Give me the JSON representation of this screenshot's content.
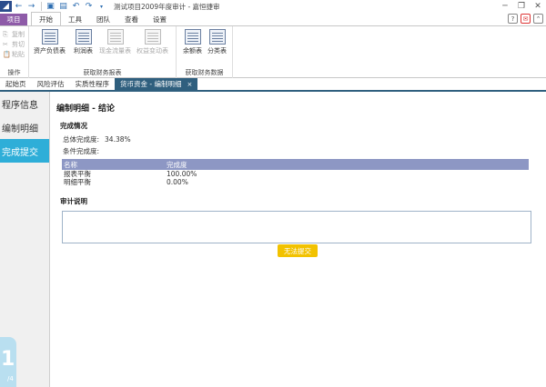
{
  "window": {
    "title": "测试项目2009年度审计 - 嘉恒捷审"
  },
  "ribbon_tabs": {
    "project": "项目",
    "tabs": [
      "开始",
      "工具",
      "团队",
      "查看",
      "设置"
    ]
  },
  "ribbon": {
    "clipboard": {
      "copy": "复制",
      "cut": "剪切",
      "paste": "粘贴",
      "group_label": "操作"
    },
    "reports": {
      "balance_sheet": "资产负债表",
      "income": "利润表",
      "cashflow": "现金流量表",
      "equity": "权益变动表",
      "group_label": "获取财务报表"
    },
    "data": {
      "balance": "余额表",
      "ledger": "分类表",
      "group_label": "获取财务数据"
    }
  },
  "doc_tabs": [
    {
      "label": "起始页"
    },
    {
      "label": "风险评估"
    },
    {
      "label": "实质性程序"
    },
    {
      "label": "货币资金 - 编制明细",
      "close": "×"
    }
  ],
  "sidenav": {
    "items": [
      {
        "label": "程序信息"
      },
      {
        "label": "编制明细"
      },
      {
        "label": "完成提交"
      }
    ],
    "page_num": "1",
    "page_total": "/4"
  },
  "main": {
    "title": "编制明细 - 结论",
    "completion_heading": "完成情况",
    "overall_label": "总体完成度:",
    "overall_value": "34.38%",
    "condition_label": "条件完成度:",
    "table": {
      "headers": [
        "名称",
        "完成度"
      ],
      "rows": [
        [
          "报表平衡",
          "100.00%"
        ],
        [
          "明细平衡",
          "0.00%"
        ]
      ]
    },
    "notes_heading": "审计说明",
    "submit_label": "无法提交"
  },
  "colors": {
    "project_tab": "#8e5ba8",
    "active_nav": "#2eaed8",
    "doc_tab_active": "#2f5f7e",
    "table_header": "#8d97c4",
    "submit": "#f2c200"
  }
}
